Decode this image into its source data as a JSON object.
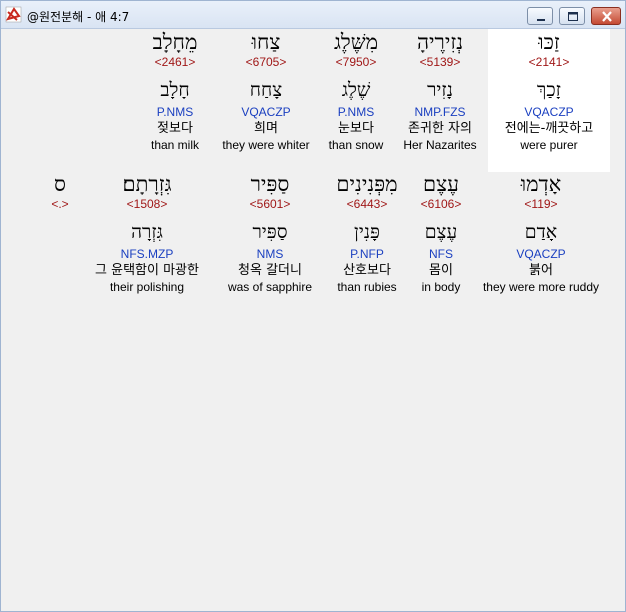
{
  "window": {
    "title": "@원전분해 - 애 4:7"
  },
  "rows": [
    {
      "cells": [
        {
          "hebrew": "זַכּוּ",
          "strong": "<2141>",
          "lemma": "זָכַךְ",
          "morph": "VQACZP",
          "korean": "전에는-깨끗하고",
          "english": "were purer"
        },
        {
          "hebrew": "נְזִירֶיהָ",
          "strong": "<5139>",
          "lemma": "נָזִיר",
          "morph": "NMP.FZS",
          "korean": "존귀한 자의",
          "english": "Her Nazarites"
        },
        {
          "hebrew": "מִשֶּׁלֶג",
          "strong": "<7950>",
          "lemma": "שֶׁלֶג",
          "morph": "P.NMS",
          "korean": "눈보다",
          "english": "than snow"
        },
        {
          "hebrew": "צַחוּ",
          "strong": "<6705>",
          "lemma": "צָחַח",
          "morph": "VQACZP",
          "korean": "희며",
          "english": "they were whiter"
        },
        {
          "hebrew": "מֵחָלָב",
          "strong": "<2461>",
          "lemma": "חָלָב",
          "morph": "P.NMS",
          "korean": "젖보다",
          "english": "than milk"
        }
      ]
    },
    {
      "cells": [
        {
          "hebrew": "אָדְמוּ",
          "strong": "<119>",
          "lemma": "אָדַם",
          "morph": "VQACZP",
          "korean": "붉어",
          "english": "they were more ruddy"
        },
        {
          "hebrew": "עֶצֶם",
          "strong": "<6106>",
          "lemma": "עֶצֶם",
          "morph": "NFS",
          "korean": "몸이",
          "english": "in body"
        },
        {
          "hebrew": "מִפְּנִינִים",
          "strong": "<6443>",
          "lemma": "פָּנִין",
          "morph": "P.NFP",
          "korean": "산호보다",
          "english": "than rubies"
        },
        {
          "hebrew": "סַפִּיר",
          "strong": "<5601>",
          "lemma": "סַפִּיר",
          "morph": "NMS",
          "korean": "청옥 갈더니",
          "english": "was of sapphire"
        },
        {
          "hebrew": "גִּזְרָתָם׃",
          "strong": "<1508>",
          "lemma": "גִּזְרָה",
          "morph": "NFS.MZP",
          "korean": "그 윤택함이 마광한",
          "english": "their polishing"
        },
        {
          "hebrew": "ס",
          "strong": "<.>",
          "lemma": "",
          "morph": "",
          "korean": "",
          "english": ""
        }
      ]
    }
  ]
}
